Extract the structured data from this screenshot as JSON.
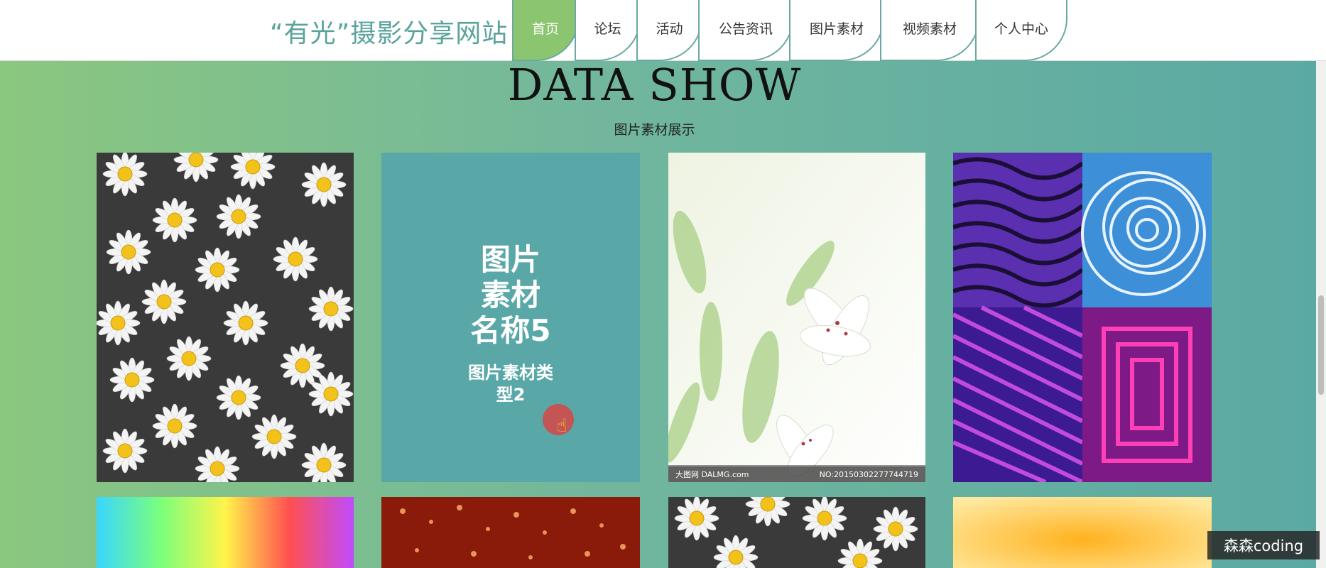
{
  "site": {
    "logo": "“有光”摄影分享网站"
  },
  "nav": {
    "tabs": [
      {
        "label": "首页",
        "active": true
      },
      {
        "label": "论坛"
      },
      {
        "label": "活动"
      },
      {
        "label": "公告资讯"
      },
      {
        "label": "图片素材"
      },
      {
        "label": "视频素材"
      },
      {
        "label": "个人中心"
      }
    ]
  },
  "main": {
    "title": "DATA SHOW",
    "subtitle": "图片素材展示",
    "cards": [
      {
        "image": "daisy-pattern"
      },
      {
        "image": "hover-card",
        "name": "图片素材名称5",
        "type": "图片素材类型2"
      },
      {
        "image": "white-lily",
        "watermark_left": "大图网 DALMG.com",
        "watermark_right": "NO:20150302277744719"
      },
      {
        "image": "psychedelic-swirls"
      },
      {
        "image": "rainbow-gradient"
      },
      {
        "image": "red-bokeh"
      },
      {
        "image": "daisy-pattern"
      },
      {
        "image": "yellow-blur"
      }
    ]
  },
  "overlay_badge": "森森coding",
  "colors": {
    "accent_green": "#8cc56f",
    "accent_teal": "#5aa7a8",
    "logo": "#5aa39c"
  }
}
